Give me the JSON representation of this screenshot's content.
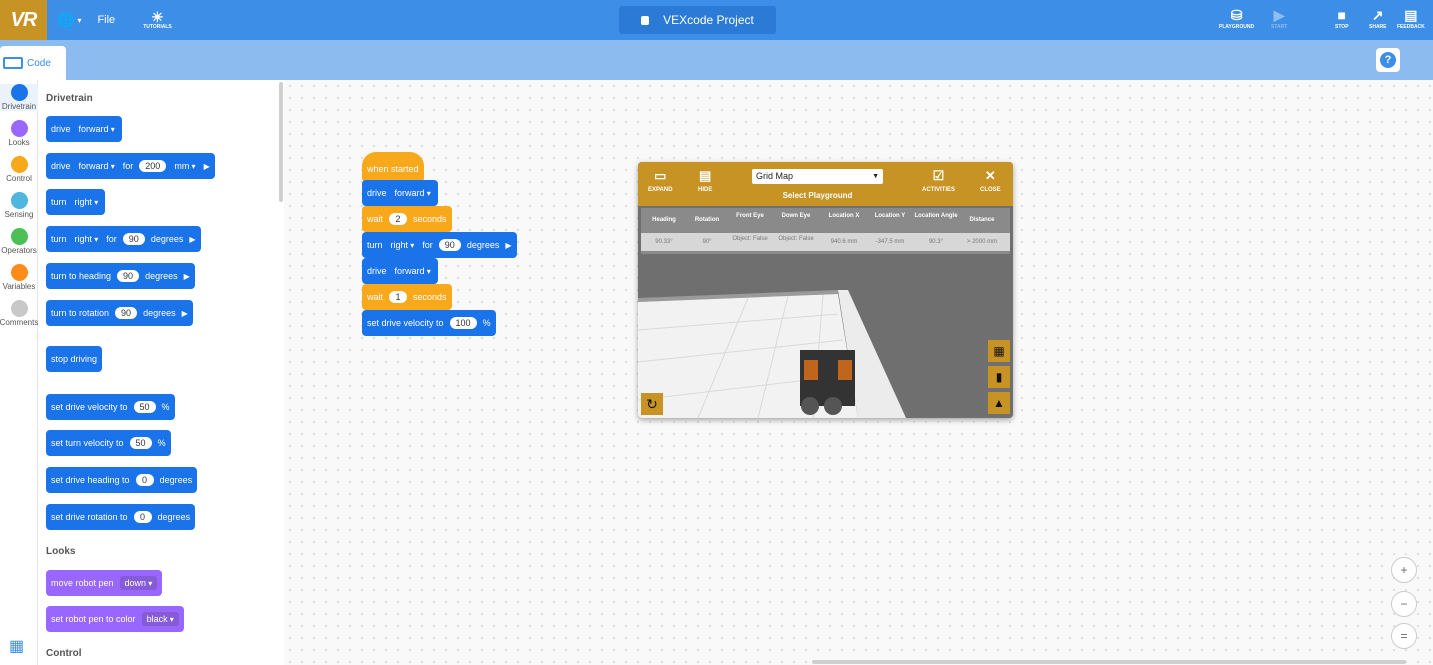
{
  "topbar": {
    "logo": "VR",
    "file_label": "File",
    "tutorials_label": "TUTORIALS",
    "project_title": "VEXcode Project",
    "playground_label": "PLAYGROUND",
    "start_label": "START",
    "stop_label": "STOP",
    "share_label": "SHARE",
    "feedback_label": "FEEDBACK"
  },
  "tabs": {
    "code_label": "Code",
    "help": "?"
  },
  "categories": [
    {
      "label": "Drivetrain",
      "color": "#1a73e8"
    },
    {
      "label": "Looks",
      "color": "#9966ff"
    },
    {
      "label": "Control",
      "color": "#f7a81b"
    },
    {
      "label": "Sensing",
      "color": "#4fb6e0"
    },
    {
      "label": "Operators",
      "color": "#4cbf56"
    },
    {
      "label": "Variables",
      "color": "#ff8c1a"
    },
    {
      "label": "Comments",
      "color": "#c8c8c8"
    }
  ],
  "palette": {
    "drivetrain_title": "Drivetrain",
    "looks_title": "Looks",
    "control_title": "Control",
    "b_drive": "drive",
    "b_forward": "forward",
    "b_for": "for",
    "b_200": "200",
    "b_mm": "mm",
    "b_turn": "turn",
    "b_right": "right",
    "b_90": "90",
    "b_degrees": "degrees",
    "b_turn_to_heading": "turn to heading",
    "b_turn_to_rotation": "turn to rotation",
    "b_stop_driving": "stop driving",
    "b_set_drive_velocity_to": "set drive velocity to",
    "b_50": "50",
    "b_pct": "%",
    "b_set_turn_velocity_to": "set turn velocity to",
    "b_set_drive_heading_to": "set drive heading to",
    "b_0": "0",
    "b_set_drive_rotation_to": "set drive rotation to",
    "b_move_robot_pen": "move robot pen",
    "b_down": "down",
    "b_set_robot_pen_to_color": "set robot pen to color",
    "b_black": "black"
  },
  "script": {
    "when_started": "when started",
    "drive": "drive",
    "forward": "forward",
    "wait": "wait",
    "v2": "2",
    "seconds": "seconds",
    "turn": "turn",
    "right": "right",
    "for": "for",
    "v90": "90",
    "degrees": "degrees",
    "v1": "1",
    "set_drive_velocity_to": "set drive velocity to",
    "v100": "100",
    "pct": "%"
  },
  "playground": {
    "expand": "EXPAND",
    "hide": "HIDE",
    "map_selected": "Grid Map",
    "select_playground": "Select Playground",
    "activities": "ACTIVITIES",
    "close": "CLOSE",
    "headers": [
      "Heading",
      "Rotation",
      "Front Eye",
      "Down Eye",
      "Location X",
      "Location Y",
      "Location Angle",
      "Distance"
    ],
    "values": [
      "90.33°",
      "90°",
      "Object: False",
      "Object: False",
      "940.6 mm",
      "-347.5 mm",
      "90.3°",
      "> 2000 mm"
    ]
  },
  "zoom": {
    "in": "+",
    "out": "−",
    "reset": "="
  }
}
